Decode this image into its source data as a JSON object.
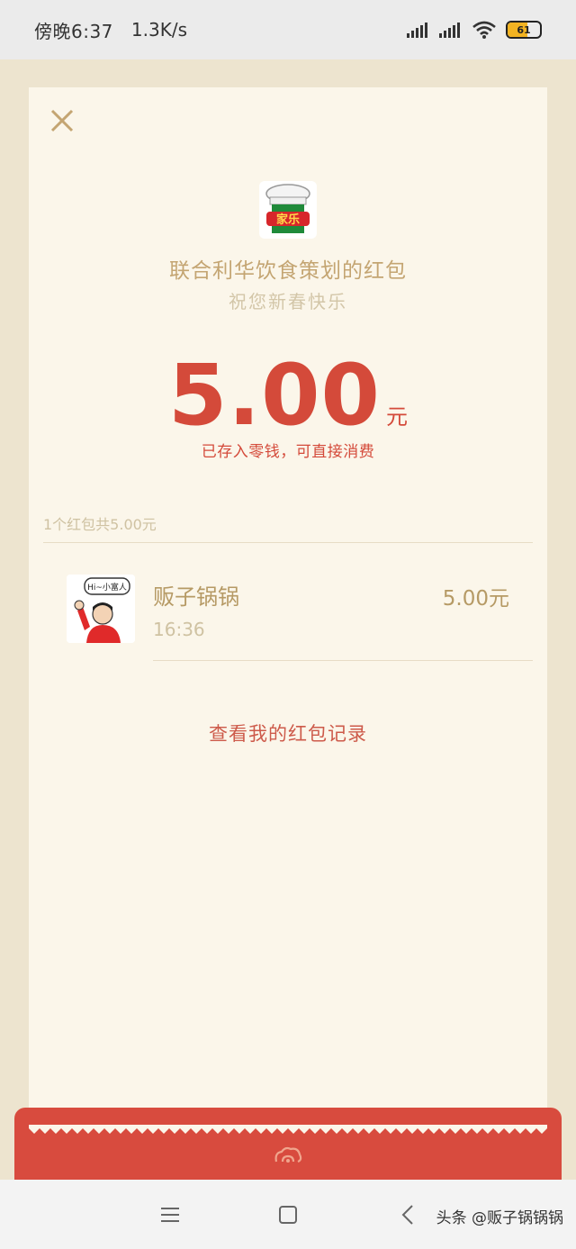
{
  "status_bar": {
    "time": "傍晚6:37",
    "speed": "1.3K/s",
    "battery": "61",
    "battery_color": "#f2b322"
  },
  "envelope": {
    "close_icon": "close-icon",
    "sender_title": "联合利华饮食策划的红包",
    "wish": "祝您新春快乐",
    "amount": "5.00",
    "unit": "元",
    "stored_text": "已存入零钱，可直接消费",
    "summary": "1个红包共5.00元",
    "accent_color": "#d44a3a"
  },
  "recipients": [
    {
      "name": "贩子锅锅",
      "time": "16:36",
      "amount": "5.00元",
      "avatar_caption": "Hi~小富人"
    }
  ],
  "records_link": "查看我的红包记录",
  "nav": {
    "menu_icon": "menu-icon",
    "home_icon": "home-icon",
    "back_icon": "back-icon",
    "watermark": "头条 @贩子锅锅锅"
  }
}
